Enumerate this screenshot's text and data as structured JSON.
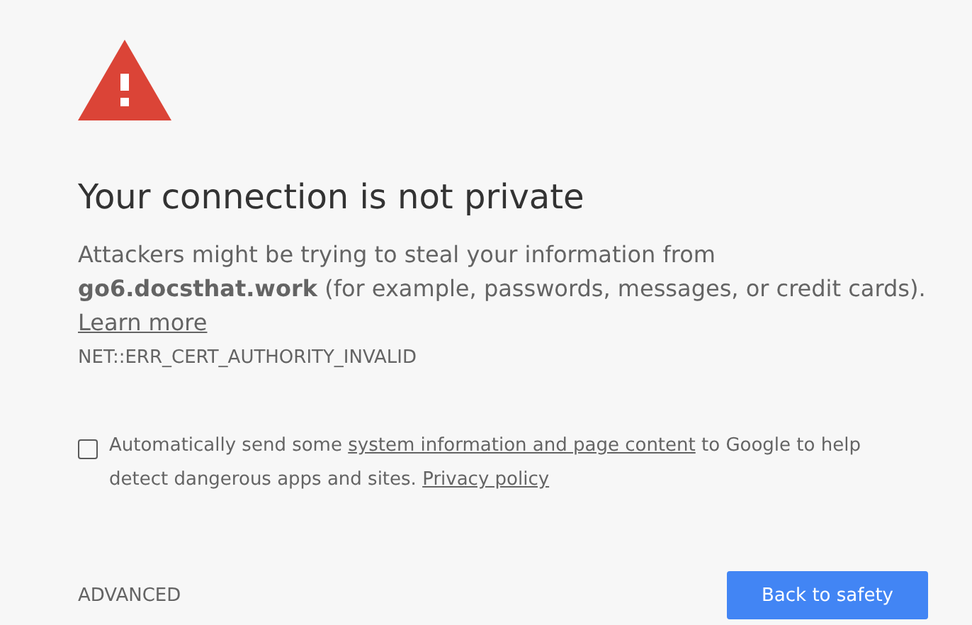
{
  "heading": "Your connection is not private",
  "description": {
    "text": "Attackers might be trying to steal your information from **go6.docsthat.work** (for example, passwords, messages, or credit cards).",
    "link": "Learn more"
  },
  "error_code": "NET::ERR_CERT_AUTHORITY_INVALID",
  "report": {
    "checked": false,
    "parts": [
      {
        "kind": "text",
        "text": "Automatically send some "
      },
      {
        "kind": "link",
        "text": "system information and page content"
      },
      {
        "kind": "text",
        "text": " to Google to help detect dangerous apps and sites. "
      },
      {
        "kind": "link",
        "text": "Privacy policy"
      }
    ]
  },
  "advanced": "ADVANCED",
  "primary_button": "Back to safety"
}
